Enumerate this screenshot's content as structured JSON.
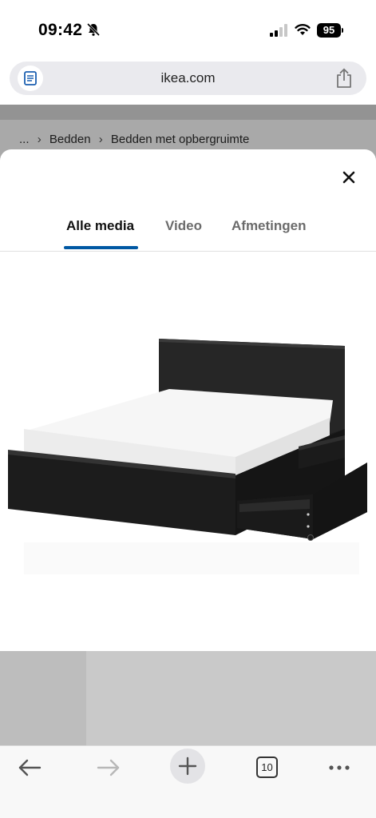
{
  "status_bar": {
    "time": "09:42",
    "battery": "95"
  },
  "browser": {
    "url": "ikea.com",
    "tab_count": "10"
  },
  "breadcrumb": {
    "ellipsis": "...",
    "items": [
      "Bedden",
      "Bedden met opbergruimte"
    ]
  },
  "media_modal": {
    "tabs": [
      {
        "label": "Alle media",
        "active": true
      },
      {
        "label": "Video",
        "active": false
      },
      {
        "label": "Afmetingen",
        "active": false
      }
    ]
  },
  "colors": {
    "accent": "#0058a3",
    "bed_frame": "#1d1d1d",
    "mattress": "#f7f7f7"
  },
  "icons": [
    "bell-slash-icon",
    "signal-icon",
    "wifi-icon",
    "reader-icon",
    "share-icon",
    "close-icon",
    "back-arrow-icon",
    "forward-arrow-icon",
    "plus-icon",
    "tabs-icon",
    "more-icon"
  ]
}
